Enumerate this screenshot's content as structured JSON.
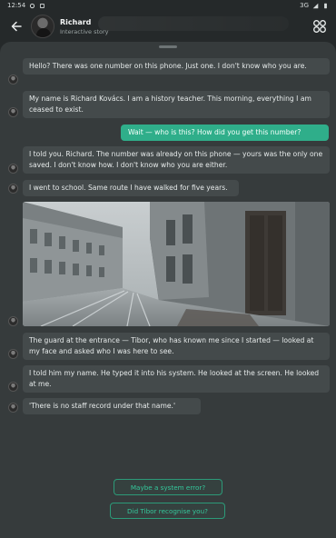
{
  "status_bar": {
    "time": "12:54",
    "network": "3G"
  },
  "header": {
    "title": "Richard",
    "subtitle": "Interactive story"
  },
  "messages": [
    {
      "sender": "character",
      "text": "Hello? There was one number on this phone. Just one. I don't know who you are."
    },
    {
      "sender": "character",
      "text": "My name is Richard Kovács. I am a history teacher. This morning, everything I am ceased to exist."
    },
    {
      "sender": "user",
      "text": "Wait — who is this? How did you get this number?"
    },
    {
      "sender": "character",
      "text": "I told you. Richard. The number was already on this phone — yours was the only one saved. I don't know how. I don't know who you are either."
    },
    {
      "sender": "character",
      "text": "I went to school. Same route I have walked for five years."
    },
    {
      "sender": "character",
      "text": "The guard at the entrance — Tibor, who has known me since I started — looked at my face and asked who I was here to see."
    },
    {
      "sender": "character",
      "text": "I told him my name. He typed it into his system. He looked at the screen. He looked at me."
    },
    {
      "sender": "character",
      "text": "'There is no staff record under that name.'"
    }
  ],
  "photo": {
    "icon": "street-photo"
  },
  "suggestions": [
    {
      "label": "Maybe a system error?"
    },
    {
      "label": "Did Tibor recognise you?"
    }
  ],
  "colors": {
    "accent": "#2fae8a",
    "bubble": "#444a4b",
    "background": "#363b3c"
  }
}
